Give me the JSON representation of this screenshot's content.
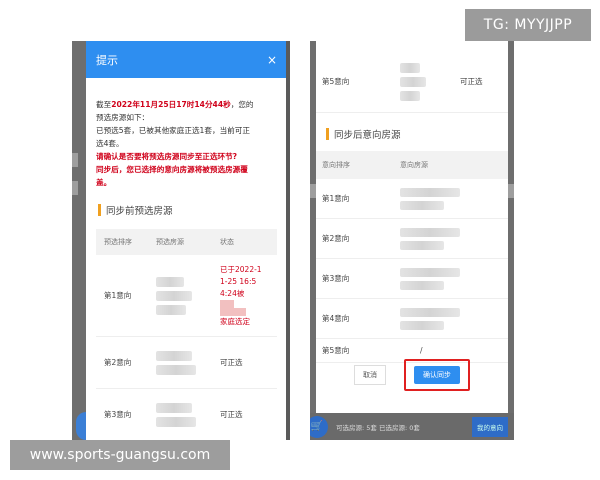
{
  "watermarks": {
    "top": "TG: MYYJJPP",
    "bottom": "www.sports-guangsu.com"
  },
  "left_modal": {
    "title": "提示",
    "close": "×",
    "notice": {
      "line1_prefix": "截至",
      "deadline": "2022年11月25日17时14分44秒",
      "line1_suffix": "，您的",
      "line2": "预选房源如下：",
      "line3": "已预选5套，已被其他家庭正选1套，当前可正",
      "line4": "选4套。",
      "warn1": "请确认是否要将预选房源同步至正选环节?",
      "warn2": "同步后，您已选择的意向房源将被预选房源覆",
      "warn3": "盖。"
    },
    "section_title": "同步前预选房源",
    "columns": [
      "预选排序",
      "预选房源",
      "状态"
    ],
    "rows": [
      {
        "rank": "第1意向",
        "status_lines": [
          "已于2022-1",
          "1-25 16:5",
          "4:24被"
        ],
        "status_tail": "家庭选定"
      },
      {
        "rank": "第2意向",
        "status": "可正选"
      },
      {
        "rank": "第3意向",
        "status": "可正选"
      }
    ]
  },
  "right_panel": {
    "top_row": {
      "rank": "第5意向",
      "status": "可正选"
    },
    "section_title": "同步后意向房源",
    "columns": [
      "意向排序",
      "意向房源"
    ],
    "rows": [
      {
        "rank": "第1意向"
      },
      {
        "rank": "第2意向"
      },
      {
        "rank": "第3意向"
      },
      {
        "rank": "第4意向"
      },
      {
        "rank": "第5意向",
        "value": "/"
      }
    ],
    "cancel_label": "取消",
    "confirm_label": "确认同步",
    "bottom_bar": {
      "summary": "可选房源: 5套  已选房源: 0套",
      "button": "我的意向"
    }
  },
  "colors": {
    "primary": "#2e8ef0",
    "warn": "#d0021b",
    "accent_bar": "#f0a020",
    "highlight_border": "#e02020"
  }
}
